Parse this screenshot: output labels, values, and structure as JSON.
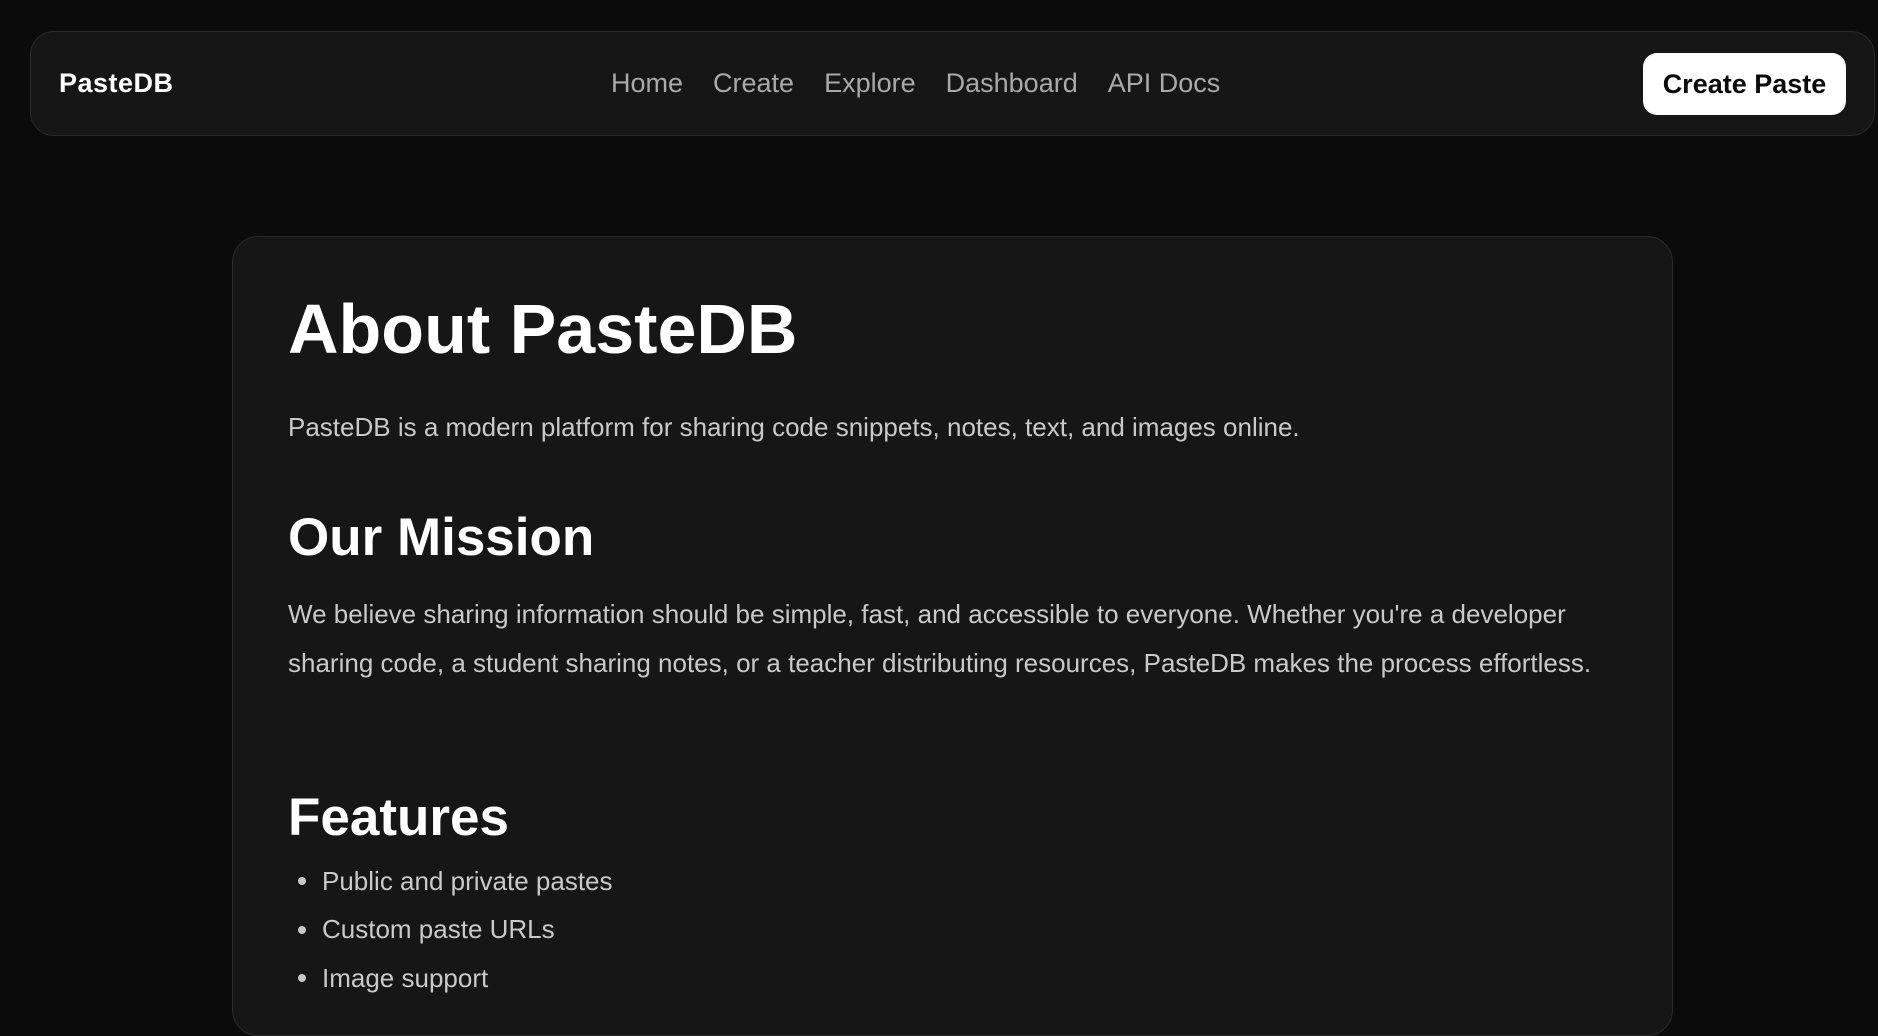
{
  "navbar": {
    "brand": "PasteDB",
    "links": [
      "Home",
      "Create",
      "Explore",
      "Dashboard",
      "API Docs"
    ],
    "cta_label": "Create Paste"
  },
  "about": {
    "title": "About PasteDB",
    "intro": "PasteDB is a modern platform for sharing code snippets, notes, text, and images online.",
    "mission_heading": "Our Mission",
    "mission_text": "We believe sharing information should be simple, fast, and accessible to everyone. Whether you're a developer sharing code, a student sharing notes, or a teacher distributing resources, PasteDB makes the process effortless.",
    "features_heading": "Features",
    "features": [
      "Public and private pastes",
      "Custom paste URLs",
      "Image support"
    ]
  },
  "colors": {
    "background": "#0b0b0b",
    "surface": "#161616",
    "border": "#2a2a2a",
    "text_primary": "#ffffff",
    "text_secondary": "#c9c9c9",
    "nav_link": "#a9a9a9",
    "cta_background": "#ffffff"
  }
}
